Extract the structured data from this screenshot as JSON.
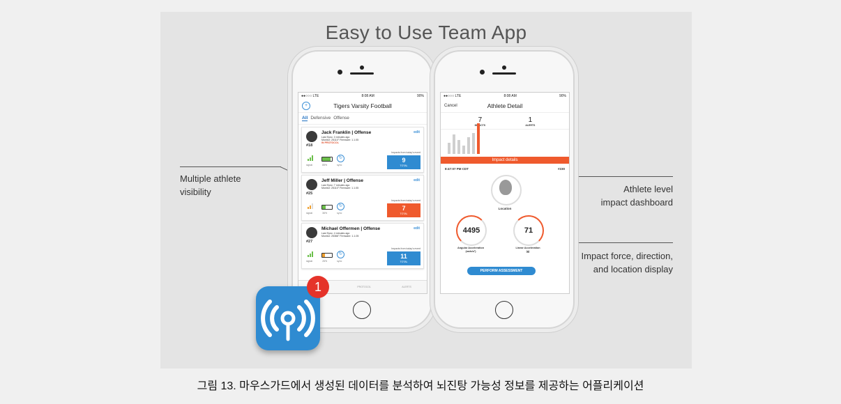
{
  "title": "Easy to Use Team App",
  "caption": "그림 13. 마우스가드에서 생성된 데이터를 분석하여 뇌진탕 가능성 정보를 제공하는 어플리케이션",
  "callouts": {
    "left_line1": "Multiple athlete",
    "left_line2": "visibility",
    "right1_line1": "Athlete level",
    "right1_line2": "impact dashboard",
    "right2_line1": "Impact force, direction,",
    "right2_line2": "and location display"
  },
  "app_badge": "1",
  "phone1": {
    "status_left": "●●○○○ LTE",
    "status_time": "8:08 AM",
    "status_right": "90%",
    "nav_title": "Tigers Varsity Football",
    "tabs": [
      "All",
      "Defensive",
      "Offense"
    ],
    "athletes": [
      {
        "name": "Jack Franklin | Offense",
        "jersey": "#18",
        "meta1": "Last Sync: 3 minutes ago",
        "meta2": "Monitor: 25110°  Firmware: 1.1.05",
        "protocol": "IN PROTOCOL",
        "total": "9",
        "total_label": "TOTAL",
        "impacts_caption": "Impacts from today's event",
        "signal": "signal",
        "battery": "85%",
        "sync": "sync",
        "edit": "edit"
      },
      {
        "name": "Jeff Miller | Offense",
        "jersey": "#25",
        "meta1": "Last Sync: 7 minutes ago",
        "meta2": "Monitor: 25110°  Firmware: 1.1.05",
        "protocol": "",
        "total": "7",
        "total_label": "TOTAL",
        "impacts_caption": "Impacts from today's event",
        "signal": "signal",
        "battery": "36%",
        "sync": "sync",
        "edit": "edit"
      },
      {
        "name": "Michael Offermen | Offense",
        "jersey": "#27",
        "meta1": "Last Sync: 4 minutes ago",
        "meta2": "Monitor: 25366°  Firmware: 1.1.05",
        "protocol": "",
        "total": "11",
        "total_label": "TOTAL",
        "impacts_caption": "Impacts from today's event",
        "signal": "signal",
        "battery": "26%",
        "sync": "sync",
        "edit": "edit"
      }
    ],
    "bottom_tabs": [
      "ATHLETES",
      "PROTOCOL",
      "ALERTS"
    ]
  },
  "phone2": {
    "status_left": "●●○○○ LTE",
    "status_time": "8:08 AM",
    "status_right": "90%",
    "nav_left": "Cancel",
    "nav_title": "Athlete Detail",
    "impacts_value": "7",
    "impacts_label": "IMPACTS",
    "alerts_value": "1",
    "alerts_label": "ALERTS",
    "impact_details": "Impact details",
    "impact_time": "8:47:07 PM CDT",
    "impact_id": "#230",
    "location_label": "Location",
    "angular_value": "4495",
    "angular_label_1": "Angular Acceleration",
    "angular_label_2": "(rads/s²)",
    "linear_value": "71",
    "linear_label_1": "Linear Acceleration",
    "linear_label_2": "(g)",
    "assess_button": "PERFORM ASSESSMENT"
  },
  "colors": {
    "blue": "#2f8bd1",
    "orange": "#ef5a2d",
    "badge": "#e5332a"
  }
}
